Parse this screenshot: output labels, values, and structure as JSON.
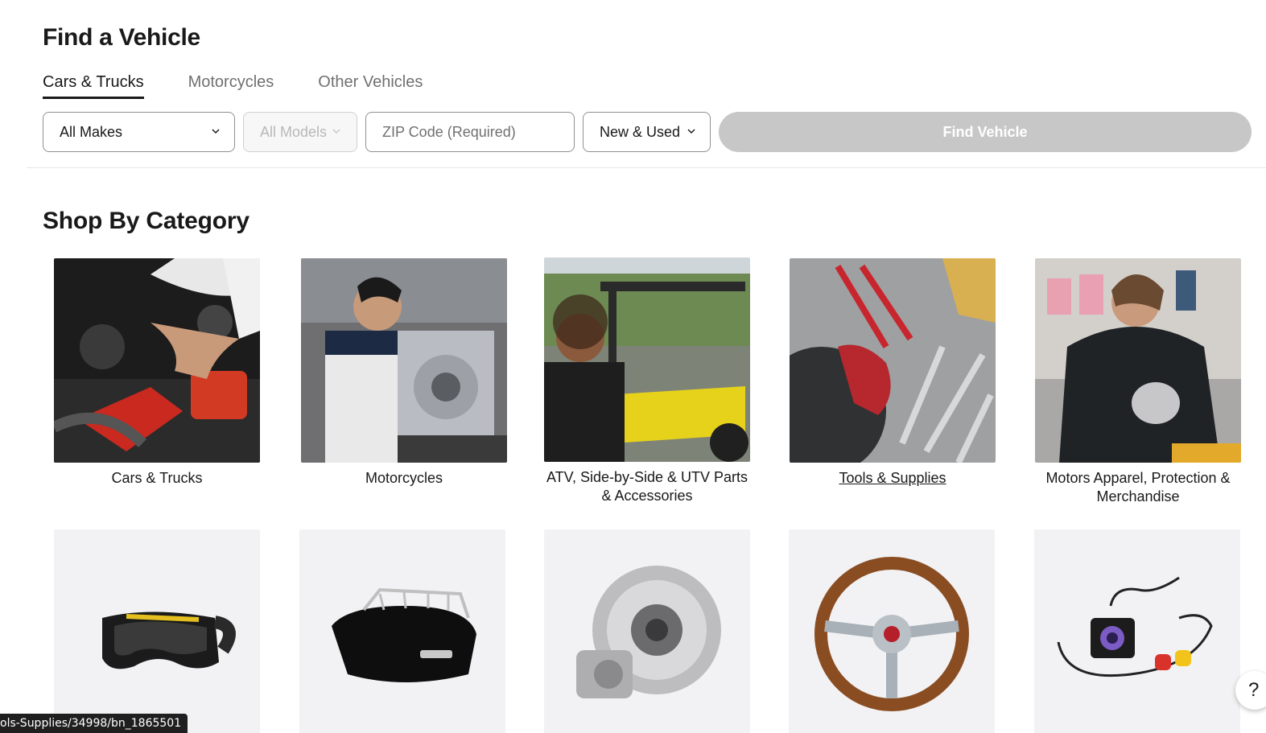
{
  "find_vehicle": {
    "title": "Find a Vehicle",
    "tabs": [
      {
        "label": "Cars & Trucks",
        "active": true
      },
      {
        "label": "Motorcycles",
        "active": false
      },
      {
        "label": "Other Vehicles",
        "active": false
      }
    ],
    "makes_select": {
      "value": "All Makes"
    },
    "models_select": {
      "value": "All Models",
      "disabled": true
    },
    "zip_input": {
      "value": "",
      "placeholder": "ZIP Code (Required)"
    },
    "condition_select": {
      "value": "New & Used"
    },
    "find_button": {
      "label": "Find Vehicle",
      "disabled": true
    }
  },
  "shop_by_category": {
    "title": "Shop By Category",
    "categories": [
      {
        "label": "Cars & Trucks",
        "icon": "engine-bay-photo"
      },
      {
        "label": "Motorcycles",
        "icon": "motorcycle-mechanic-photo"
      },
      {
        "label": "ATV, Side-by-Side & UTV Parts & Accessories",
        "icon": "utv-photo"
      },
      {
        "label": "Tools & Supplies",
        "icon": "tools-photo",
        "hovered": true
      },
      {
        "label": "Motors Apparel, Protection & Merchandise",
        "icon": "apparel-photo"
      }
    ],
    "products": [
      {
        "icon": "goggles-icon"
      },
      {
        "icon": "trunk-case-icon"
      },
      {
        "icon": "turbo-icon"
      },
      {
        "icon": "steering-wheel-icon"
      },
      {
        "icon": "backup-camera-icon"
      }
    ]
  },
  "status_bar": {
    "url": "ols-Supplies/34998/bn_1865501"
  },
  "help_button": {
    "label": "?"
  },
  "colors": {
    "text": "#191919",
    "muted": "#707070",
    "button_disabled": "#c7c7c7",
    "border": "#8f8f8f"
  }
}
